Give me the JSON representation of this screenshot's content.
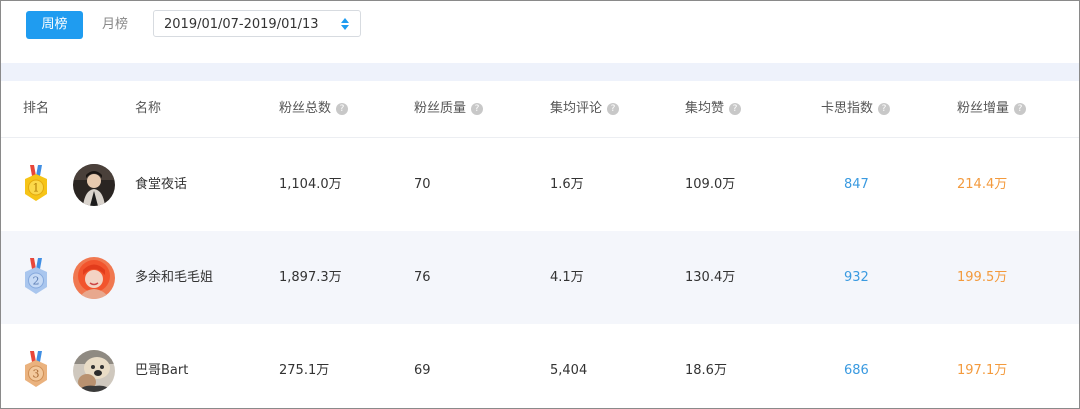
{
  "tabs": {
    "week": "周榜",
    "month": "月榜"
  },
  "date_range": {
    "value": "2019/01/07-2019/01/13",
    "icon": "sort-arrows-icon"
  },
  "columns": {
    "rank": "排名",
    "name": "名称",
    "fans_total": "粉丝总数",
    "fans_quality": "粉丝质量",
    "avg_comment": "集均评论",
    "avg_like": "集均赞",
    "kasi_index": "卡思指数",
    "fans_growth": "粉丝增量",
    "help_glyph": "?"
  },
  "rows": [
    {
      "rank": "1",
      "name": "食堂夜话",
      "fans_total": "1,104.0万",
      "fans_quality": "70",
      "avg_comment": "1.6万",
      "avg_like": "109.0万",
      "kasi_index": "847",
      "fans_growth": "214.4万",
      "medal": "gold-medal-icon"
    },
    {
      "rank": "2",
      "name": "多余和毛毛姐",
      "fans_total": "1,897.3万",
      "fans_quality": "76",
      "avg_comment": "4.1万",
      "avg_like": "130.4万",
      "kasi_index": "932",
      "fans_growth": "199.5万",
      "medal": "silver-medal-icon"
    },
    {
      "rank": "3",
      "name": "巴哥Bart",
      "fans_total": "275.1万",
      "fans_quality": "69",
      "avg_comment": "5,404",
      "avg_like": "18.6万",
      "kasi_index": "686",
      "fans_growth": "197.1万",
      "medal": "bronze-medal-icon"
    }
  ],
  "colors": {
    "accent": "#1f9cf0",
    "index_blue": "#3a9ae0",
    "growth_orange": "#f39a3d",
    "gold": "#f6c417",
    "silver": "#a9c6ee",
    "bronze": "#eab27e"
  }
}
